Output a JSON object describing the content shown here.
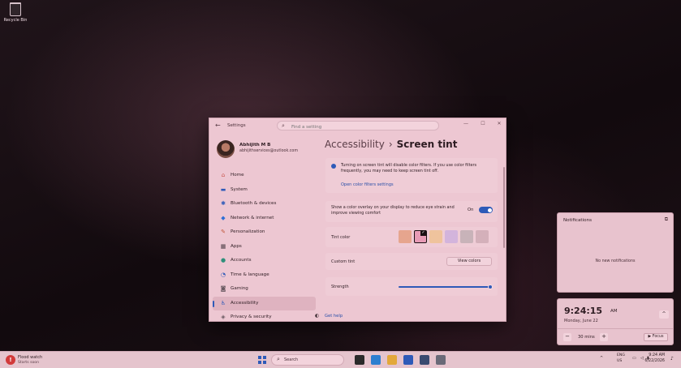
{
  "desktop": {
    "recycle_bin": "Recycle Bin"
  },
  "window": {
    "title": "Settings",
    "back_glyph": "←",
    "search_placeholder": "Find a setting",
    "controls": {
      "minimize": "—",
      "maximize": "☐",
      "close": "✕"
    },
    "profile": {
      "name": "Abhijith M B",
      "email": "abhijithservices@outlook.com"
    },
    "nav": [
      {
        "label": "Home",
        "icon": "⌂",
        "icon_color": "#c9564f"
      },
      {
        "label": "System",
        "icon": "▬",
        "icon_color": "#2e5ab8"
      },
      {
        "label": "Bluetooth & devices",
        "icon": "✱",
        "icon_color": "#2e5ab8"
      },
      {
        "label": "Network & internet",
        "icon": "◆",
        "icon_color": "#2f6fd6"
      },
      {
        "label": "Personalization",
        "icon": "✎",
        "icon_color": "#c2563a"
      },
      {
        "label": "Apps",
        "icon": "▦",
        "icon_color": "#4a3d44"
      },
      {
        "label": "Accounts",
        "icon": "●",
        "icon_color": "#2f8f7a"
      },
      {
        "label": "Time & language",
        "icon": "◔",
        "icon_color": "#2e5ab8"
      },
      {
        "label": "Gaming",
        "icon": "◙",
        "icon_color": "#6a5a62"
      },
      {
        "label": "Accessibility",
        "icon": "♿",
        "icon_color": "#2e5ab8"
      },
      {
        "label": "Privacy & security",
        "icon": "◈",
        "icon_color": "#6a5a62"
      }
    ],
    "active_nav": "Accessibility",
    "heading": {
      "crumb": "Accessibility",
      "sep": "›",
      "current": "Screen tint"
    },
    "info": {
      "text": "Turning on screen tint will disable color filters. If you use color filters frequently, you may need to keep screen tint off.",
      "link": "Open color filters settings"
    },
    "overlay": {
      "text": "Show a color overlay on your display to reduce eye strain and improve viewing comfort",
      "state": "On"
    },
    "tint": {
      "label": "Tint color",
      "colors": [
        "#e6a58e",
        "#e79bb6",
        "#efc39d",
        "#d3b4dc",
        "#c8b3b9",
        "#d4b0ba"
      ],
      "selected_index": 1
    },
    "custom_tint": {
      "label": "Custom tint",
      "button": "View colors"
    },
    "strength": {
      "label": "Strength",
      "value_percent": 100
    },
    "help": {
      "label": "Get help",
      "icon": "◐"
    }
  },
  "notifications": {
    "title": "Notifications",
    "settings_icon": "⧉",
    "empty": "No new notifications"
  },
  "clock": {
    "time": "9:24:15",
    "ampm": "AM",
    "date": "Monday, June 22",
    "caret": "^",
    "minus": "−",
    "minutes": "30 mins",
    "plus": "+",
    "focus": "▶ Focus"
  },
  "taskbar": {
    "weather": {
      "title": "Flood watch",
      "subtitle": "Starts soon",
      "badge": "!"
    },
    "search_label": "Search",
    "search_icon": "⌕",
    "apps": [
      {
        "name": "task-view",
        "color": "#2a2a2a"
      },
      {
        "name": "edge",
        "color": "#2d7fd0"
      },
      {
        "name": "file-explorer",
        "color": "#e3a83a"
      },
      {
        "name": "mail",
        "color": "#2e5ab8"
      },
      {
        "name": "store",
        "color": "#3a4a70"
      },
      {
        "name": "settings",
        "color": "#6a6a78"
      }
    ],
    "tray_up": "^",
    "lang": "ENG",
    "region": "US",
    "time": "9:24 AM",
    "date": "6/22/2026"
  }
}
